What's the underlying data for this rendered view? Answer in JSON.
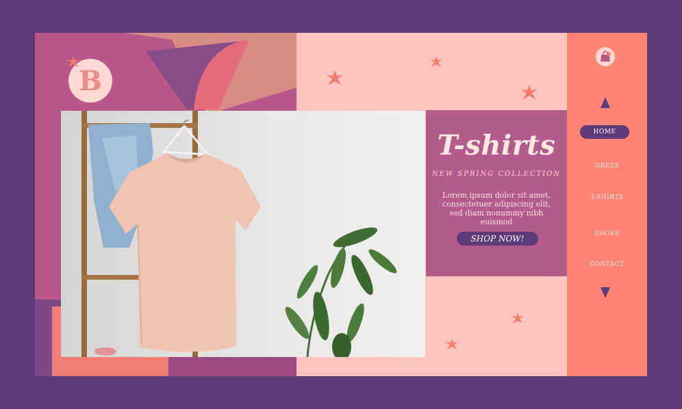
{
  "brand": {
    "logo_letter": "B"
  },
  "hero": {
    "title": "T-shirts",
    "subtitle": "NEW SPRING COLLECTION",
    "description": "Lorem ipsum dolor sit amet, consectetuer adipiscing elit, sed diam nonummy nibh euismod",
    "cta_label": "SHOP NOW!"
  },
  "nav": {
    "items": [
      {
        "label": "HOME",
        "active": true
      },
      {
        "label": "DRESS",
        "active": false
      },
      {
        "label": "T-SHIRTS",
        "active": false
      },
      {
        "label": "SHOES",
        "active": false
      },
      {
        "label": "CONTACT",
        "active": false
      }
    ],
    "icons": {
      "cart": "shopping-bag-icon",
      "up": "triangle-up-icon",
      "down": "triangle-down-icon"
    }
  },
  "colors": {
    "outer": "#5e3a78",
    "pink_light": "#ffc4c0",
    "magenta": "#b35b8a",
    "coral": "#fe8474",
    "accent_star": "#f47a6c"
  }
}
